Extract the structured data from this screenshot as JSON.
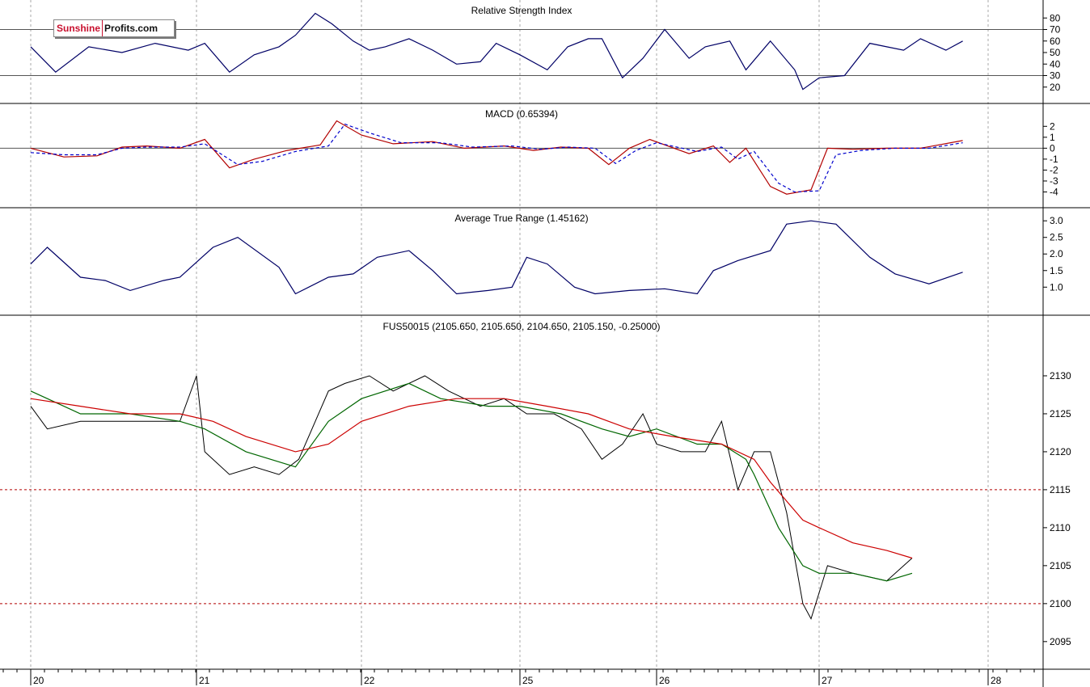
{
  "logo": {
    "brand_a": "Sunshine",
    "brand_b": "Profits.com"
  },
  "chart_data": [
    {
      "type": "line",
      "title": "Relative Strength Index",
      "ylim": [
        10,
        90
      ],
      "yticks": [
        20,
        30,
        40,
        50,
        60,
        70,
        80
      ],
      "reference_lines": [
        30,
        70
      ],
      "series": [
        {
          "color": "#000066",
          "x": [
            0,
            0.15,
            0.35,
            0.55,
            0.75,
            0.95,
            1.05,
            1.2,
            1.35,
            1.5,
            1.6,
            1.72,
            1.82,
            1.95,
            2.05,
            2.15,
            2.3,
            2.45,
            2.6,
            2.75,
            2.85,
            3.0,
            3.2,
            3.35,
            3.5,
            3.6,
            3.75,
            3.9,
            4.05,
            4.2,
            4.3,
            4.45,
            4.55,
            4.7,
            4.85,
            4.9,
            5.0,
            5.15,
            5.3,
            5.4,
            5.5,
            5.6,
            5.75,
            5.85
          ],
          "y": [
            55,
            33,
            55,
            50,
            58,
            52,
            58,
            33,
            48,
            55,
            65,
            84,
            75,
            60,
            52,
            55,
            62,
            52,
            40,
            42,
            58,
            48,
            35,
            55,
            62,
            62,
            28,
            45,
            70,
            45,
            55,
            60,
            35,
            60,
            35,
            18,
            28,
            30,
            58,
            55,
            52,
            62,
            52,
            60
          ]
        }
      ]
    },
    {
      "type": "line",
      "title": "MACD (0.65394)",
      "ylim": [
        -5,
        3.5
      ],
      "yticks": [
        2,
        1,
        0,
        -1,
        -2,
        -3,
        -4
      ],
      "reference_lines": [
        0
      ],
      "series": [
        {
          "color": "#b20000",
          "x": [
            0,
            0.2,
            0.4,
            0.55,
            0.7,
            0.9,
            1.05,
            1.2,
            1.35,
            1.55,
            1.75,
            1.85,
            2.0,
            2.2,
            2.45,
            2.65,
            2.9,
            3.1,
            3.3,
            3.5,
            3.65,
            3.8,
            3.95,
            4.2,
            4.35,
            4.45,
            4.55,
            4.7,
            4.8,
            4.95,
            5.05,
            5.2,
            5.4,
            5.6,
            5.85
          ],
          "y": [
            0,
            -0.8,
            -0.7,
            0.1,
            0.2,
            0,
            0.8,
            -1.8,
            -1.0,
            -0.2,
            0.3,
            2.5,
            1.2,
            0.4,
            0.6,
            0,
            0.2,
            -0.2,
            0.1,
            0,
            -1.5,
            0,
            0.8,
            -0.5,
            0.2,
            -1.3,
            0,
            -3.5,
            -4.2,
            -3.8,
            0,
            -0.1,
            0,
            0,
            0.7
          ]
        },
        {
          "color": "#0000cc",
          "x": [
            0,
            0.2,
            0.4,
            0.55,
            0.7,
            0.9,
            1.05,
            1.25,
            1.4,
            1.6,
            1.8,
            1.9,
            2.05,
            2.25,
            2.5,
            2.7,
            2.95,
            3.15,
            3.35,
            3.55,
            3.7,
            3.85,
            4.0,
            4.25,
            4.4,
            4.5,
            4.6,
            4.75,
            4.85,
            5.0,
            5.1,
            5.25,
            5.45,
            5.65,
            5.85
          ],
          "y": [
            -0.4,
            -0.6,
            -0.6,
            0,
            0.1,
            0.1,
            0.4,
            -1.5,
            -1.2,
            -0.3,
            0.2,
            2.2,
            1.4,
            0.5,
            0.5,
            0.1,
            0.2,
            -0.1,
            0.1,
            0,
            -1.4,
            -0.2,
            0.5,
            -0.3,
            0.1,
            -1.0,
            -0.3,
            -3.2,
            -4.0,
            -3.9,
            -0.6,
            -0.2,
            0,
            0,
            0.5
          ]
        }
      ]
    },
    {
      "type": "line",
      "title": "Average True Range (1.45162)",
      "ylim": [
        0.3,
        3.2
      ],
      "yticks": [
        3.0,
        2.5,
        2.0,
        1.5,
        1.0
      ],
      "series": [
        {
          "color": "#000066",
          "x": [
            0,
            0.1,
            0.3,
            0.45,
            0.6,
            0.8,
            0.9,
            1.1,
            1.25,
            1.5,
            1.6,
            1.8,
            1.95,
            2.1,
            2.3,
            2.45,
            2.6,
            2.8,
            2.95,
            3.05,
            3.2,
            3.4,
            3.55,
            3.8,
            4.05,
            4.25,
            4.35,
            4.5,
            4.7,
            4.8,
            4.95,
            5.1,
            5.3,
            5.45,
            5.65,
            5.85
          ],
          "y": [
            1.7,
            2.2,
            1.3,
            1.2,
            0.9,
            1.2,
            1.3,
            2.2,
            2.5,
            1.6,
            0.8,
            1.3,
            1.4,
            1.9,
            2.1,
            1.5,
            0.8,
            0.9,
            1.0,
            1.9,
            1.7,
            1.0,
            0.8,
            0.9,
            0.95,
            0.8,
            1.5,
            1.8,
            2.1,
            2.9,
            3.0,
            2.9,
            1.9,
            1.4,
            1.1,
            1.45
          ]
        }
      ]
    },
    {
      "type": "line",
      "title": "FUS50015 (2105.650, 2105.650, 2104.650, 2105.150, -0.25000)",
      "ylim": [
        2092,
        2135
      ],
      "yticks": [
        2130,
        2125,
        2120,
        2115,
        2110,
        2105,
        2100,
        2095
      ],
      "reference_lines": [
        2115,
        2100
      ],
      "x_ticks": [
        "20",
        "21",
        "22",
        "25",
        "26",
        "27",
        "28"
      ],
      "series": [
        {
          "color": "#000000",
          "x": [
            0,
            0.1,
            0.3,
            0.5,
            0.7,
            0.9,
            1.0,
            1.05,
            1.2,
            1.35,
            1.5,
            1.62,
            1.8,
            1.9,
            2.05,
            2.2,
            2.4,
            2.55,
            2.75,
            2.9,
            3.05,
            3.25,
            3.45,
            3.6,
            3.75,
            3.9,
            4.0,
            4.15,
            4.3,
            4.4,
            4.5,
            4.6,
            4.7,
            4.8,
            4.9,
            4.95,
            5.05,
            5.2,
            5.4,
            5.55
          ],
          "y": [
            2126,
            2123,
            2124,
            2124,
            2124,
            2124,
            2130,
            2120,
            2117,
            2118,
            2117,
            2119,
            2128,
            2129,
            2130,
            2128,
            2130,
            2128,
            2126,
            2127,
            2125,
            2125,
            2123,
            2119,
            2121,
            2125,
            2121,
            2120,
            2120,
            2124,
            2115,
            2120,
            2120,
            2112,
            2100,
            2098,
            2105,
            2104,
            2103,
            2106
          ]
        },
        {
          "color": "#006600",
          "x": [
            0,
            0.1,
            0.3,
            0.6,
            0.9,
            1.05,
            1.3,
            1.6,
            1.8,
            2.0,
            2.3,
            2.5,
            2.8,
            3.0,
            3.3,
            3.6,
            3.8,
            4.0,
            4.25,
            4.4,
            4.55,
            4.6,
            4.75,
            4.9,
            5.0,
            5.2,
            5.4,
            5.55
          ],
          "y": [
            2128,
            2127,
            2125,
            2125,
            2124,
            2123,
            2120,
            2118,
            2124,
            2127,
            2129,
            2127,
            2126,
            2126,
            2125,
            2123,
            2122,
            2123,
            2121,
            2121,
            2119,
            2117,
            2110,
            2105,
            2104,
            2104,
            2103,
            2104
          ]
        },
        {
          "color": "#cc0000",
          "x": [
            0,
            0.3,
            0.6,
            0.9,
            1.1,
            1.3,
            1.6,
            1.8,
            2.0,
            2.3,
            2.6,
            2.9,
            3.2,
            3.5,
            3.8,
            4.1,
            4.4,
            4.6,
            4.7,
            4.9,
            5.0,
            5.2,
            5.4,
            5.55
          ],
          "y": [
            2127,
            2126,
            2125,
            2125,
            2124,
            2122,
            2120,
            2121,
            2124,
            2126,
            2127,
            2127,
            2126,
            2125,
            2123,
            2122,
            2121,
            2119,
            2116,
            2111,
            2110,
            2108,
            2107,
            2106
          ]
        }
      ]
    }
  ]
}
